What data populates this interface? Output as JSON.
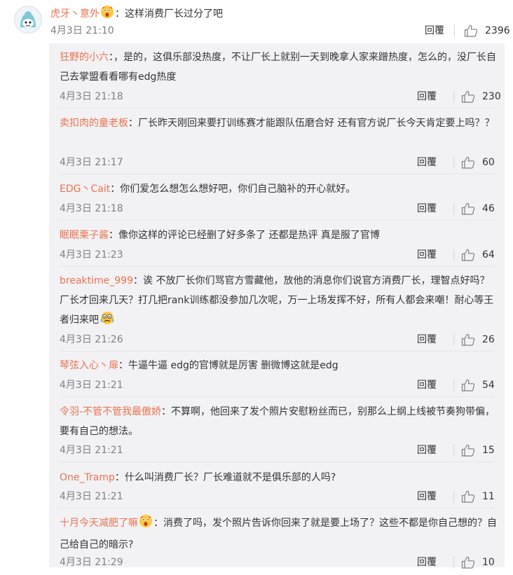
{
  "main_comment": {
    "username": "虎牙丶意外",
    "emoji_icon": "surprised-face-icon",
    "text": "：这样消费厂长过分了吧",
    "time": "4月3日 21:10",
    "reply_label": "回覆",
    "likes": "2396"
  },
  "replies": [
    {
      "username": "狂野的小六",
      "text": "：，是的，这俱乐部没热度，不让厂长上就别一天到晚拿人家来蹭热度，怎么的，没厂长自己去掌盟看看哪有edg热度",
      "time": "4月3日 21:18",
      "reply_label": "回覆",
      "likes": "230"
    },
    {
      "username": "卖扣肉的童老板",
      "text": "：厂长昨天刚回来要打训练赛才能跟队伍磨合好 还有官方说厂长今天肯定要上吗？？",
      "time": "4月3日 21:17",
      "reply_label": "回覆",
      "likes": "60"
    },
    {
      "username": "EDG丶Cait",
      "text": "：你们爱怎么想怎么想好吧，你们自己脑补的开心就好。",
      "time": "4月3日 21:18",
      "reply_label": "回覆",
      "likes": "46"
    },
    {
      "username": "眠眠栗子酱",
      "text": "：像你这样的评论已经删了好多条了 还都是热评 真是服了官博",
      "time": "4月3日 21:23",
      "reply_label": "回覆",
      "likes": "64"
    },
    {
      "username": "breaktime_999",
      "text": "：诶  不放厂长你们骂官方雪藏他，放他的消息你们说官方消费厂长，理智点好吗？厂长才回来几天？打几把rank训练都没参加几次呢，万一上场发挥不好，所有人都会来嘲！耐心等王者归来吧",
      "emoji_icon": "crying-face-icon",
      "time": "4月3日 21:26",
      "reply_label": "回覆",
      "likes": "26"
    },
    {
      "username": "琴弦入心丶扉",
      "text": "：牛逼牛逼  edg的官博就是厉害 删微博这就是edg",
      "time": "4月3日 21:21",
      "reply_label": "回覆",
      "likes": "54"
    },
    {
      "username": "令羽-不管不管我最傲娇",
      "text": "：不算啊，他回来了发个照片安慰粉丝而已，别那么上纲上线被节奏狗带偏，要有自己的想法。",
      "time": "4月3日 21:21",
      "reply_label": "回覆",
      "likes": "15"
    },
    {
      "username": "One_Tramp",
      "text": "：什么叫消费厂长？厂长难道就不是俱乐部的人吗?",
      "time": "4月3日 21:21",
      "reply_label": "回覆",
      "likes": "11"
    },
    {
      "username": "十月今天减肥了嘛",
      "emoji_after_name": "surprised-face-icon",
      "text": "：消费了吗，发个照片告诉你回来了就是要上场了？这些不都是你自己想的？自己给自己的暗示?",
      "time": "4月3日 21:29",
      "reply_label": "回覆",
      "likes": "10"
    }
  ]
}
